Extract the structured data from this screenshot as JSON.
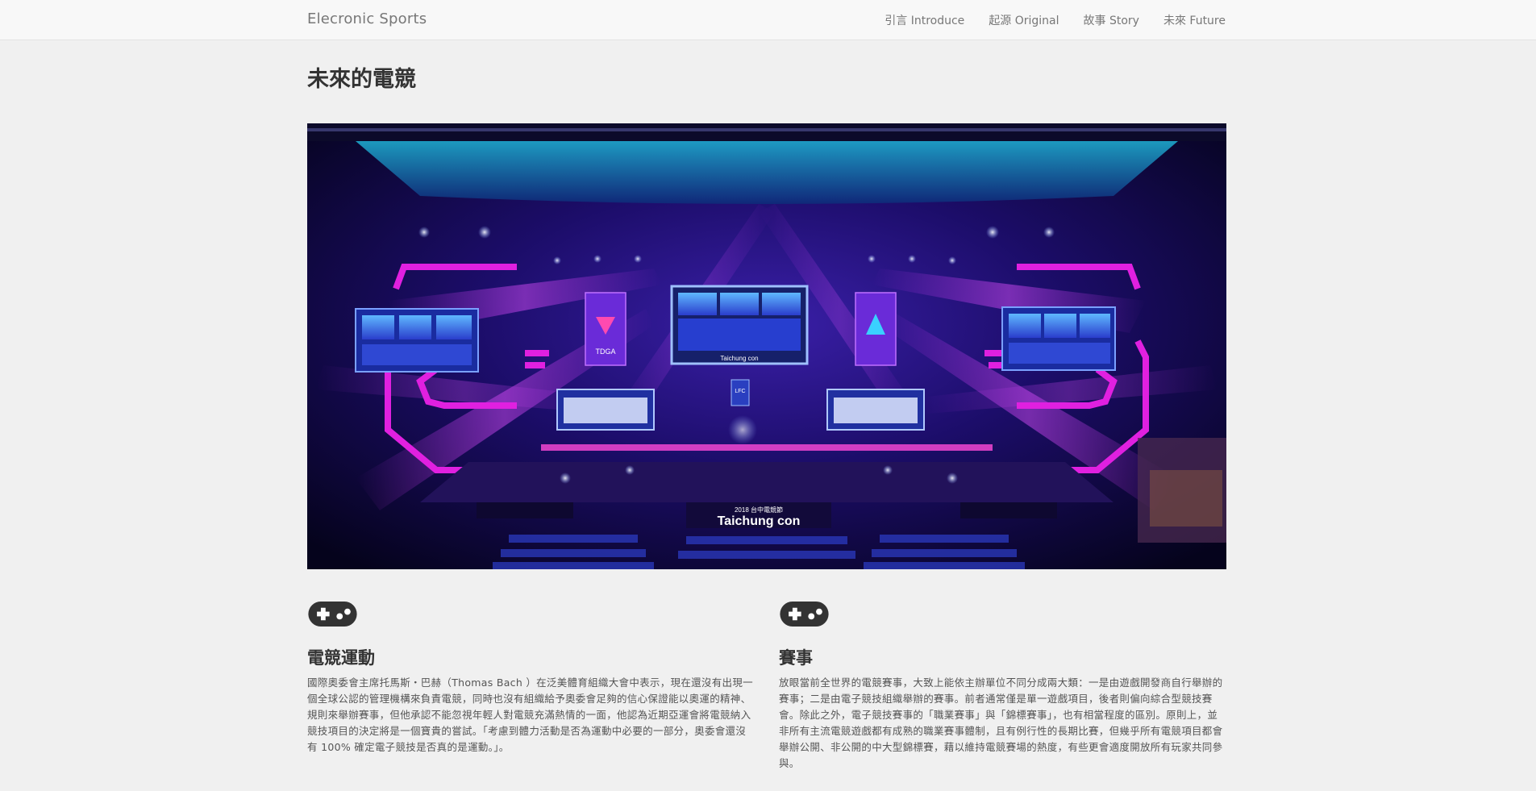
{
  "navbar": {
    "brand": "Elecronic Sports",
    "links": [
      {
        "label": "引言 Introduce"
      },
      {
        "label": "起源 Original"
      },
      {
        "label": "故事 Story"
      },
      {
        "label": "未來 Future"
      }
    ]
  },
  "page": {
    "title": "未來的電競"
  },
  "hero": {
    "alt": "2018 台中電競節 Taichung con 舞台",
    "stage_banner_small": "2018 台中電競節",
    "stage_banner_large": "Taichung con",
    "screen_caption": "Taichung con",
    "left_flag": "TDGA",
    "center_badge": "LFC"
  },
  "columns": [
    {
      "icon": "gamepad-icon",
      "heading": "電競運動",
      "body": "國際奧委會主席托馬斯・巴赫（Thomas Bach ）在泛美體育組織大會中表示，現在還沒有出現一個全球公認的管理機構來負責電競，同時也沒有組織給予奧委會足夠的信心保證能以奧運的精神、規則來舉辦賽事，但他承認不能忽視年輕人對電競充滿熱情的一面，他認為近期亞運會將電競納入競技項目的決定將是一個寶貴的嘗試。「考慮到體力活動是否為運動中必要的一部分，奧委會還沒有 100% 確定電子競技是否真的是運動。」。"
    },
    {
      "icon": "gamepad-icon",
      "heading": "賽事",
      "body": "放眼當前全世界的電競賽事，大致上能依主辦單位不同分成兩大類：一是由遊戲開發商自行舉辦的賽事；二是由電子競技組織舉辦的賽事。前者通常僅是單一遊戲項目，後者則偏向綜合型競技賽會。除此之外，電子競技賽事的「職業賽事」與「錦標賽事」，也有相當程度的區別。原則上，並非所有主流電競遊戲都有成熟的職業賽事體制，且有例行性的長期比賽，但幾乎所有電競項目都會舉辦公開、非公開的中大型錦標賽，藉以維持電競賽場的熱度，有些更會適度開放所有玩家共同參與。"
    }
  ],
  "colors": {
    "navbar_bg": "#f8f8f8",
    "page_bg": "#f0f0f0",
    "stage_magenta": "#e020e0",
    "stage_blue": "#2a1a8a"
  }
}
